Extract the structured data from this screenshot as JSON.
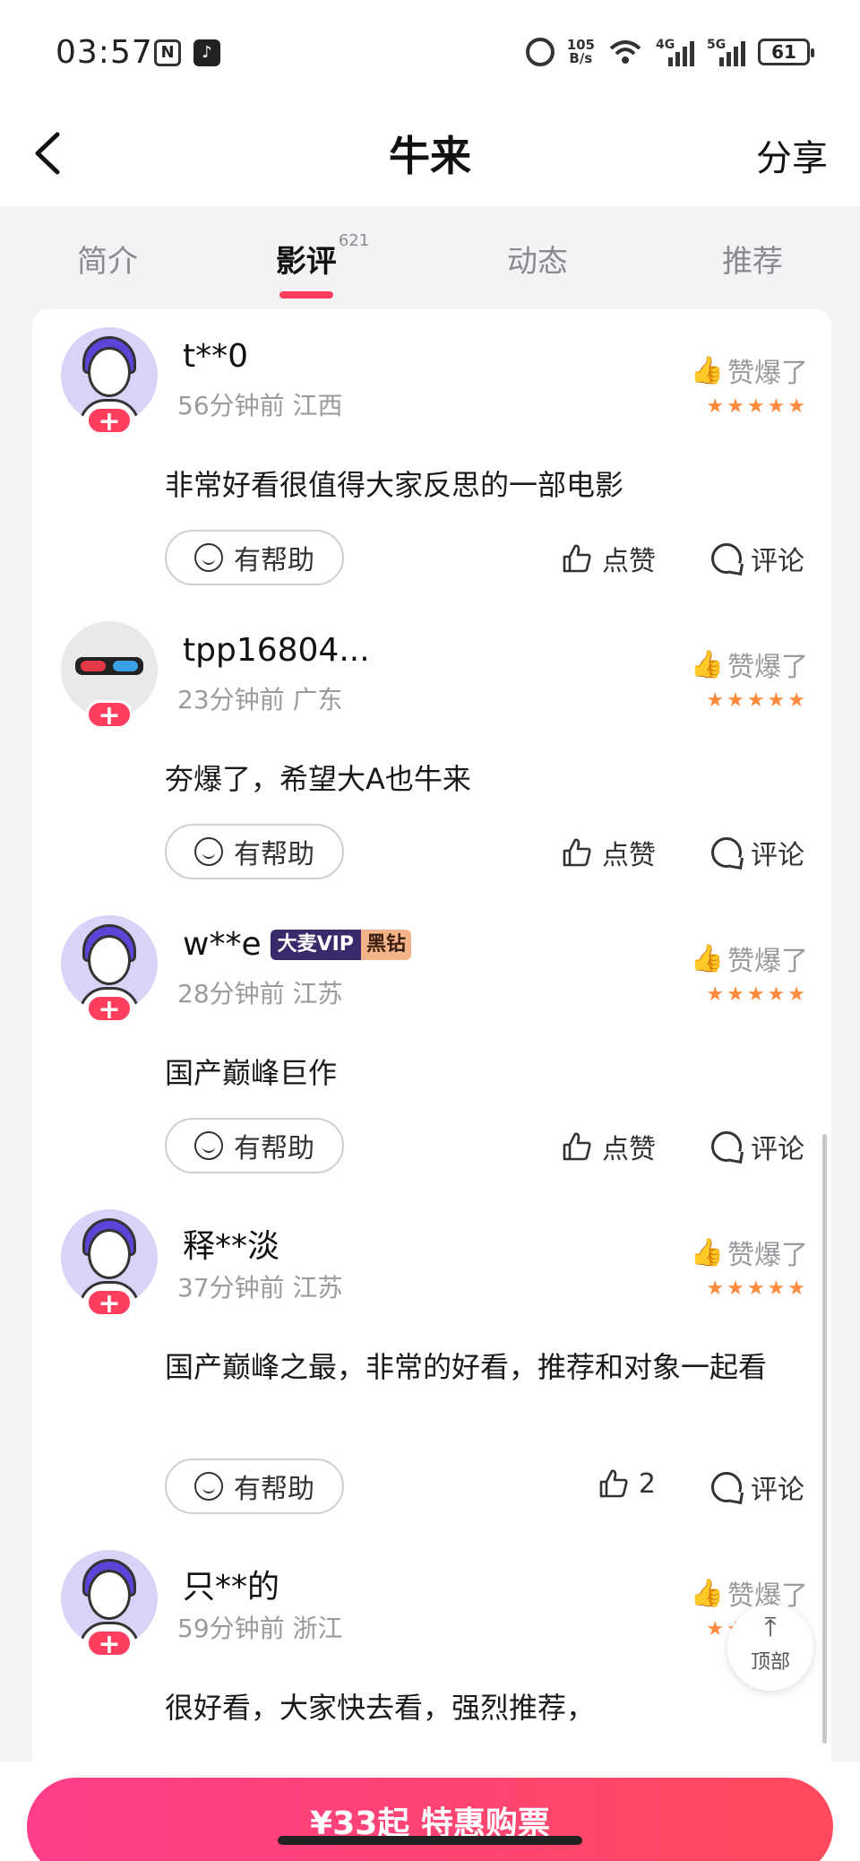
{
  "status_bar": {
    "time": "03:57",
    "nfc": "N",
    "speed_value": "105",
    "speed_unit": "B/s",
    "net1": "4G",
    "net2": "5G",
    "battery": "61"
  },
  "nav": {
    "title": "牛来",
    "share_label": "分享"
  },
  "tabs": [
    {
      "label": "简介",
      "count": ""
    },
    {
      "label": "影评",
      "count": "621",
      "active": true
    },
    {
      "label": "动态",
      "count": ""
    },
    {
      "label": "推荐",
      "count": ""
    }
  ],
  "reviews": [
    {
      "name": "t**0",
      "time": "56分钟前",
      "region": "江西",
      "verdict": "赞爆了",
      "stars": "★★★★★",
      "text": "非常好看很值得大家反思的一部电影",
      "helpful": "有帮助",
      "like": "点赞",
      "comment": "评论"
    },
    {
      "name": "tpp16804...",
      "time": "23分钟前",
      "region": "广东",
      "verdict": "赞爆了",
      "stars": "★★★★★",
      "text": "夯爆了，希望大A也牛来",
      "helpful": "有帮助",
      "like": "点赞",
      "comment": "评论"
    },
    {
      "name": "w**e",
      "badge_vip": "大麦VIP",
      "badge_level": "黑钻",
      "time": "28分钟前",
      "region": "江苏",
      "verdict": "赞爆了",
      "stars": "★★★★★",
      "text": "国产巅峰巨作",
      "helpful": "有帮助",
      "like": "点赞",
      "comment": "评论"
    },
    {
      "name": "释**淡",
      "time": "37分钟前",
      "region": "江苏",
      "verdict": "赞爆了",
      "stars": "★★★★★",
      "text": "国产巅峰之最，非常的好看，推荐和对象一起看",
      "helpful": "有帮助",
      "like": "2",
      "comment": "评论"
    },
    {
      "name": "只**的",
      "time": "59分钟前",
      "region": "浙江",
      "verdict": "赞爆了",
      "stars": "★★★★★",
      "text": "很好看，大家快去看，强烈推荐，"
    }
  ],
  "follow_symbol": "+",
  "to_top": {
    "label": "顶部"
  },
  "buy": {
    "label": "¥33起 特惠购票"
  }
}
